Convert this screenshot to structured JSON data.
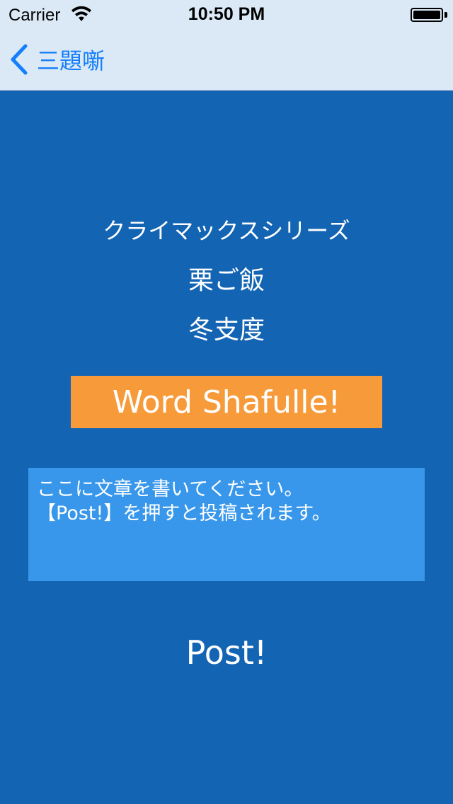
{
  "status_bar": {
    "carrier": "Carrier",
    "time": "10:50 PM",
    "wifi_icon": "wifi-icon",
    "battery_icon": "battery-icon"
  },
  "nav": {
    "back_label": "三題噺",
    "back_icon": "chevron-left-icon",
    "tint_color": "#147efb",
    "bar_color": "#dbe9f6"
  },
  "words": {
    "word1": "クライマックスシリーズ",
    "word2": "栗ご飯",
    "word3": "冬支度"
  },
  "shuffle_button": {
    "label": "Word Shafulle!",
    "color": "#f79a3a"
  },
  "text_area": {
    "value": "ここに文章を書いてください。\n【Post!】を押すと投稿されます。",
    "color": "#3897ea"
  },
  "post_button": {
    "label": "Post!"
  },
  "background_color": "#1464b4"
}
